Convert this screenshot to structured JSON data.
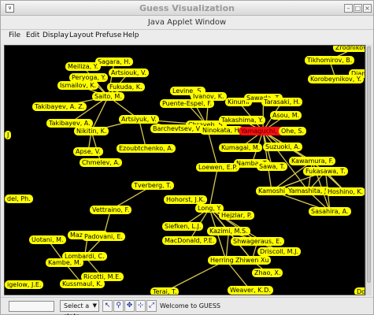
{
  "window": {
    "title": "Guess Visualization",
    "subtitle": "Java Applet Window",
    "sys_icon": "∨",
    "buttons": {
      "minimize": "–",
      "maximize": "□",
      "close": "×"
    }
  },
  "menu": [
    "File",
    "Edit",
    "Display",
    "Layout",
    "Prefuse",
    "Help"
  ],
  "graph": {
    "background": "#000000",
    "node_color": "#ffff00",
    "edge_color": "#d8c850",
    "highlight_color": "#ff1010",
    "nodes": [
      "Zrodnikov, P.",
      "Tikhomirov, B.",
      "Diamon",
      "Korobeynikov, Y.",
      "Sagara, H.",
      "Meiliza, Y.",
      "Artsiouk, V.",
      "Peryoga, Y.",
      "Ismailov, K.",
      "Fukuda, K.",
      "Saito, M.",
      "Takibayev, A. Z.",
      "Levine, S.",
      "Ivanov, K.",
      "Puente-Espel, F.",
      "Kinumi",
      "Sawada, T.",
      "Tarasaki, H.",
      "Asou, M.",
      "Takibayev, A.",
      "Artsiyuk, V.",
      "Nikitin, K.",
      "Chrayeb, S.",
      "Barchevtsev, V.",
      "Ninokata, H.",
      "Takashima, Y.",
      "Yamaguchi, K.",
      "Ohe, S.",
      "Kumagai, M.",
      "Suzuoki, A.",
      "Apse, V.",
      "Ezoubtchenko, A.",
      "Chmelev, A.",
      "Namba, T.",
      "Sawa, T.",
      "Kawamura, F.",
      "Fukasawa, T.",
      "Loewen, E.P.",
      "Kamoshi",
      "Yamashita, J.",
      "Hoshino, K.",
      "Sasahira, A.",
      "Tverberg, T.",
      "Hohorst, J.K.",
      "Long, Y.",
      "Vettraino, F.",
      "Hejzlar, P.",
      "Siefken, L.J.",
      "Kazimi, M.S.",
      "MacDonald, P.E.",
      "Shwageraus, E.",
      "Mazzola, A.",
      "Padovani, E.",
      "Driscoll, M.J.",
      "Herring, J.",
      "Zhiwen Xu",
      "Uotani, M.",
      "Lombardi, C.",
      "Zhao, X.",
      "Kambe, M.",
      "Ricotti, M.E.",
      "Kussmaul, K.",
      "Terai, T.",
      "Weaver, K.D.",
      "igelow, J.E.",
      "del, Ph.",
      "J",
      "Do"
    ]
  },
  "status": {
    "state_select": "Select a state",
    "message": "Welcome to GUESS",
    "tools": [
      "pointer-icon",
      "zoom-icon",
      "move-icon",
      "select-icon",
      "expand-icon"
    ]
  }
}
